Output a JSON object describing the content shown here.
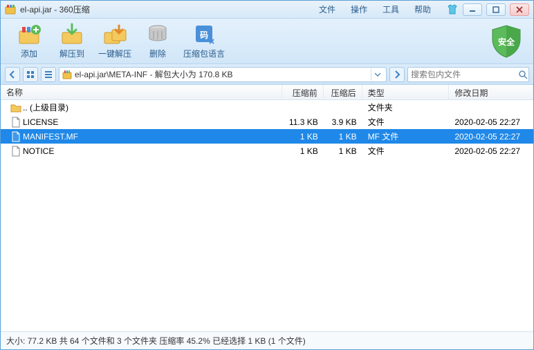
{
  "window": {
    "title": "el-api.jar - 360压缩"
  },
  "menus": {
    "file": "文件",
    "operate": "操作",
    "tools": "工具",
    "help": "帮助"
  },
  "toolbar": {
    "add": "添加",
    "extract": "解压到",
    "oneclick": "一键解压",
    "delete": "删除",
    "lang": "压缩包语言",
    "shield": "安全"
  },
  "addressbar": {
    "path": "el-api.jar\\META-INF - 解包大小为 170.8 KB"
  },
  "search": {
    "placeholder": "搜索包内文件"
  },
  "columns": {
    "name": "名称",
    "before": "压缩前",
    "after": "压缩后",
    "type": "类型",
    "date": "修改日期"
  },
  "rows": [
    {
      "icon": "folder-up",
      "name": ".. (上级目录)",
      "before": "",
      "after": "",
      "type": "文件夹",
      "date": "",
      "selected": false
    },
    {
      "icon": "file",
      "name": "LICENSE",
      "before": "11.3 KB",
      "after": "3.9 KB",
      "type": "文件",
      "date": "2020-02-05 22:27",
      "selected": false
    },
    {
      "icon": "file",
      "name": "MANIFEST.MF",
      "before": "1 KB",
      "after": "1 KB",
      "type": "MF 文件",
      "date": "2020-02-05 22:27",
      "selected": true
    },
    {
      "icon": "file",
      "name": "NOTICE",
      "before": "1 KB",
      "after": "1 KB",
      "type": "文件",
      "date": "2020-02-05 22:27",
      "selected": false
    }
  ],
  "status": "大小: 77.2 KB 共 64 个文件和 3 个文件夹 压缩率 45.2% 已经选择 1 KB (1 个文件)"
}
